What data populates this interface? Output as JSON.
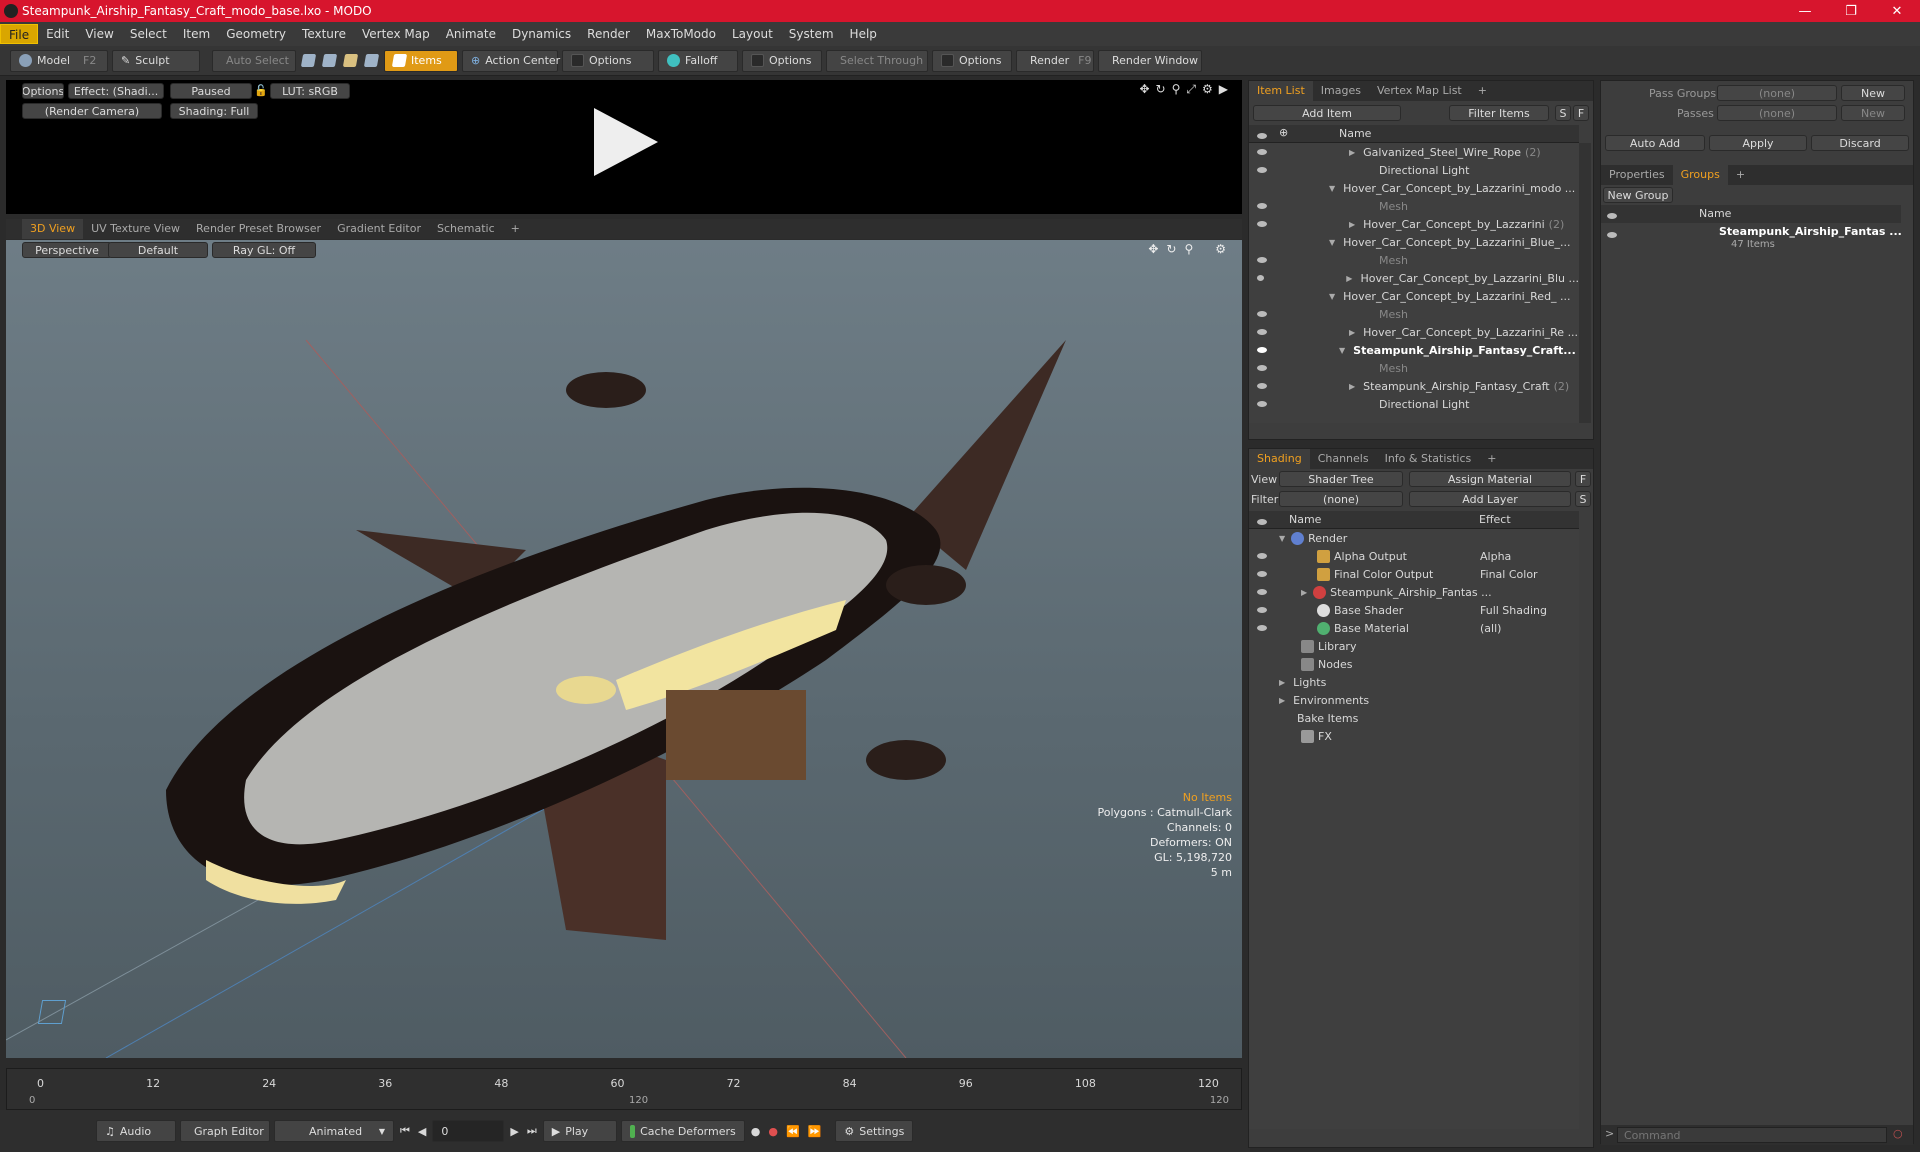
{
  "window": {
    "title": "Steampunk_Airship_Fantasy_Craft_modo_base.lxo - MODO"
  },
  "menu": [
    "File",
    "Edit",
    "View",
    "Select",
    "Item",
    "Geometry",
    "Texture",
    "Vertex Map",
    "Animate",
    "Dynamics",
    "Render",
    "MaxToModo",
    "Layout",
    "System",
    "Help"
  ],
  "toolbar": {
    "model": "Model",
    "model_key": "F2",
    "sculpt": "Sculpt",
    "auto_select": "Auto Select",
    "items": "Items",
    "action_center": "Action Center",
    "options1": "Options",
    "falloff": "Falloff",
    "options2": "Options",
    "select_through": "Select Through",
    "options3": "Options",
    "render": "Render",
    "render_key": "F9",
    "render_window": "Render Window"
  },
  "preview": {
    "options": "Options",
    "effect": "Effect: (Shadi...",
    "paused": "Paused",
    "lut": "LUT: sRGB",
    "camera": "(Render Camera)",
    "shading": "Shading: Full"
  },
  "viewtabs": [
    "3D View",
    "UV Texture View",
    "Render Preset Browser",
    "Gradient Editor",
    "Schematic",
    "+"
  ],
  "viewport": {
    "perspective": "Perspective",
    "default": "Default",
    "raygl": "Ray GL: Off",
    "hud": {
      "items": "No Items",
      "polygons": "Polygons : Catmull-Clark",
      "channels": "Channels: 0",
      "deformers": "Deformers: ON",
      "gl": "GL: 5,198,720",
      "scale": "5 m"
    }
  },
  "timeline": {
    "ticks": [
      "0",
      "12",
      "24",
      "36",
      "48",
      "60",
      "72",
      "84",
      "96",
      "108",
      "120"
    ],
    "start": "0",
    "mid": "120",
    "end": "120"
  },
  "bottom": {
    "audio": "Audio",
    "graph": "Graph Editor",
    "animated": "Animated",
    "frame": "0",
    "play": "Play",
    "cache": "Cache Deformers",
    "settings": "Settings"
  },
  "itemlist": {
    "tabs": [
      "Item List",
      "Images",
      "Vertex Map List",
      "+"
    ],
    "add_item": "Add Item",
    "filter": "Filter Items",
    "s": "S",
    "f": "F",
    "col_name": "Name",
    "rows": [
      {
        "label": "Galvanized_Steel_Wire_Rope",
        "count": "(2)"
      },
      {
        "label": "Directional Light",
        "count": ""
      },
      {
        "label": "Hover_Car_Concept_by_Lazzarini_modo ...",
        "count": ""
      },
      {
        "label": "Mesh",
        "count": ""
      },
      {
        "label": "Hover_Car_Concept_by_Lazzarini",
        "count": "(2)"
      },
      {
        "label": "Hover_Car_Concept_by_Lazzarini_Blue_...",
        "count": ""
      },
      {
        "label": "Mesh",
        "count": ""
      },
      {
        "label": "Hover_Car_Concept_by_Lazzarini_Blu ...",
        "count": ""
      },
      {
        "label": "Hover_Car_Concept_by_Lazzarini_Red_ ...",
        "count": ""
      },
      {
        "label": "Mesh",
        "count": ""
      },
      {
        "label": "Hover_Car_Concept_by_Lazzarini_Re ...",
        "count": ""
      },
      {
        "label": "Steampunk_Airship_Fantasy_Craft...",
        "count": ""
      },
      {
        "label": "Mesh",
        "count": ""
      },
      {
        "label": "Steampunk_Airship_Fantasy_Craft",
        "count": "(2)"
      },
      {
        "label": "Directional Light",
        "count": ""
      }
    ]
  },
  "shading": {
    "tabs": [
      "Shading",
      "Channels",
      "Info & Statistics",
      "+"
    ],
    "view_label": "View",
    "view_value": "Shader Tree",
    "assign": "Assign Material",
    "f": "F",
    "filter_label": "Filter",
    "filter_value": "(none)",
    "add_layer": "Add Layer",
    "s": "S",
    "col_name": "Name",
    "col_effect": "Effect",
    "rows": [
      {
        "label": "Render",
        "effect": ""
      },
      {
        "label": "Alpha Output",
        "effect": "Alpha"
      },
      {
        "label": "Final Color Output",
        "effect": "Final Color"
      },
      {
        "label": "Steampunk_Airship_Fantas ...",
        "effect": ""
      },
      {
        "label": "Base Shader",
        "effect": "Full Shading"
      },
      {
        "label": "Base Material",
        "effect": "(all)"
      },
      {
        "label": "Library",
        "effect": ""
      },
      {
        "label": "Nodes",
        "effect": ""
      },
      {
        "label": "Lights",
        "effect": ""
      },
      {
        "label": "Environments",
        "effect": ""
      },
      {
        "label": "Bake Items",
        "effect": ""
      },
      {
        "label": "FX",
        "effect": ""
      }
    ]
  },
  "groups": {
    "pass_groups": "Pass Groups",
    "passes": "Passes",
    "none1": "(none)",
    "none2": "(none)",
    "new1": "New",
    "new2": "New",
    "auto_add": "Auto Add",
    "apply": "Apply",
    "discard": "Discard",
    "tabs": [
      "Properties",
      "Groups",
      "+"
    ],
    "new_group": "New Group",
    "col_name": "Name",
    "item_name": "Steampunk_Airship_Fantas ...",
    "item_count": "47 Items"
  },
  "command": {
    "placeholder": "Command"
  }
}
